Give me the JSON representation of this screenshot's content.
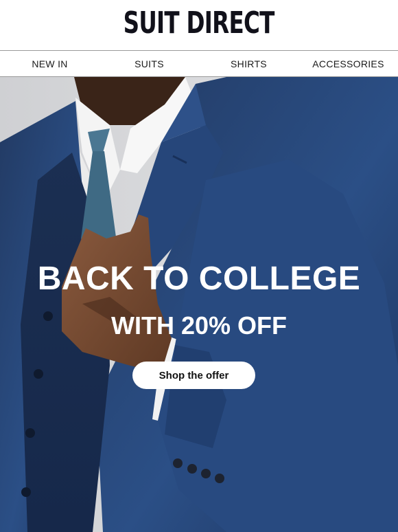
{
  "header": {
    "logo_text": "SUIT DIRECT"
  },
  "nav": {
    "items": [
      "NEW IN",
      "SUITS",
      "SHIRTS",
      "ACCESSORIES"
    ]
  },
  "hero": {
    "image_icon": "man-in-navy-suit-photo",
    "title": "BACK TO COLLEGE",
    "subtitle": "WITH 20% OFF",
    "cta_label": "Shop the offer"
  },
  "colors": {
    "suit_navy": "#1f3a6a",
    "tie_blue": "#3f6a84",
    "background": "#d9dadd"
  }
}
